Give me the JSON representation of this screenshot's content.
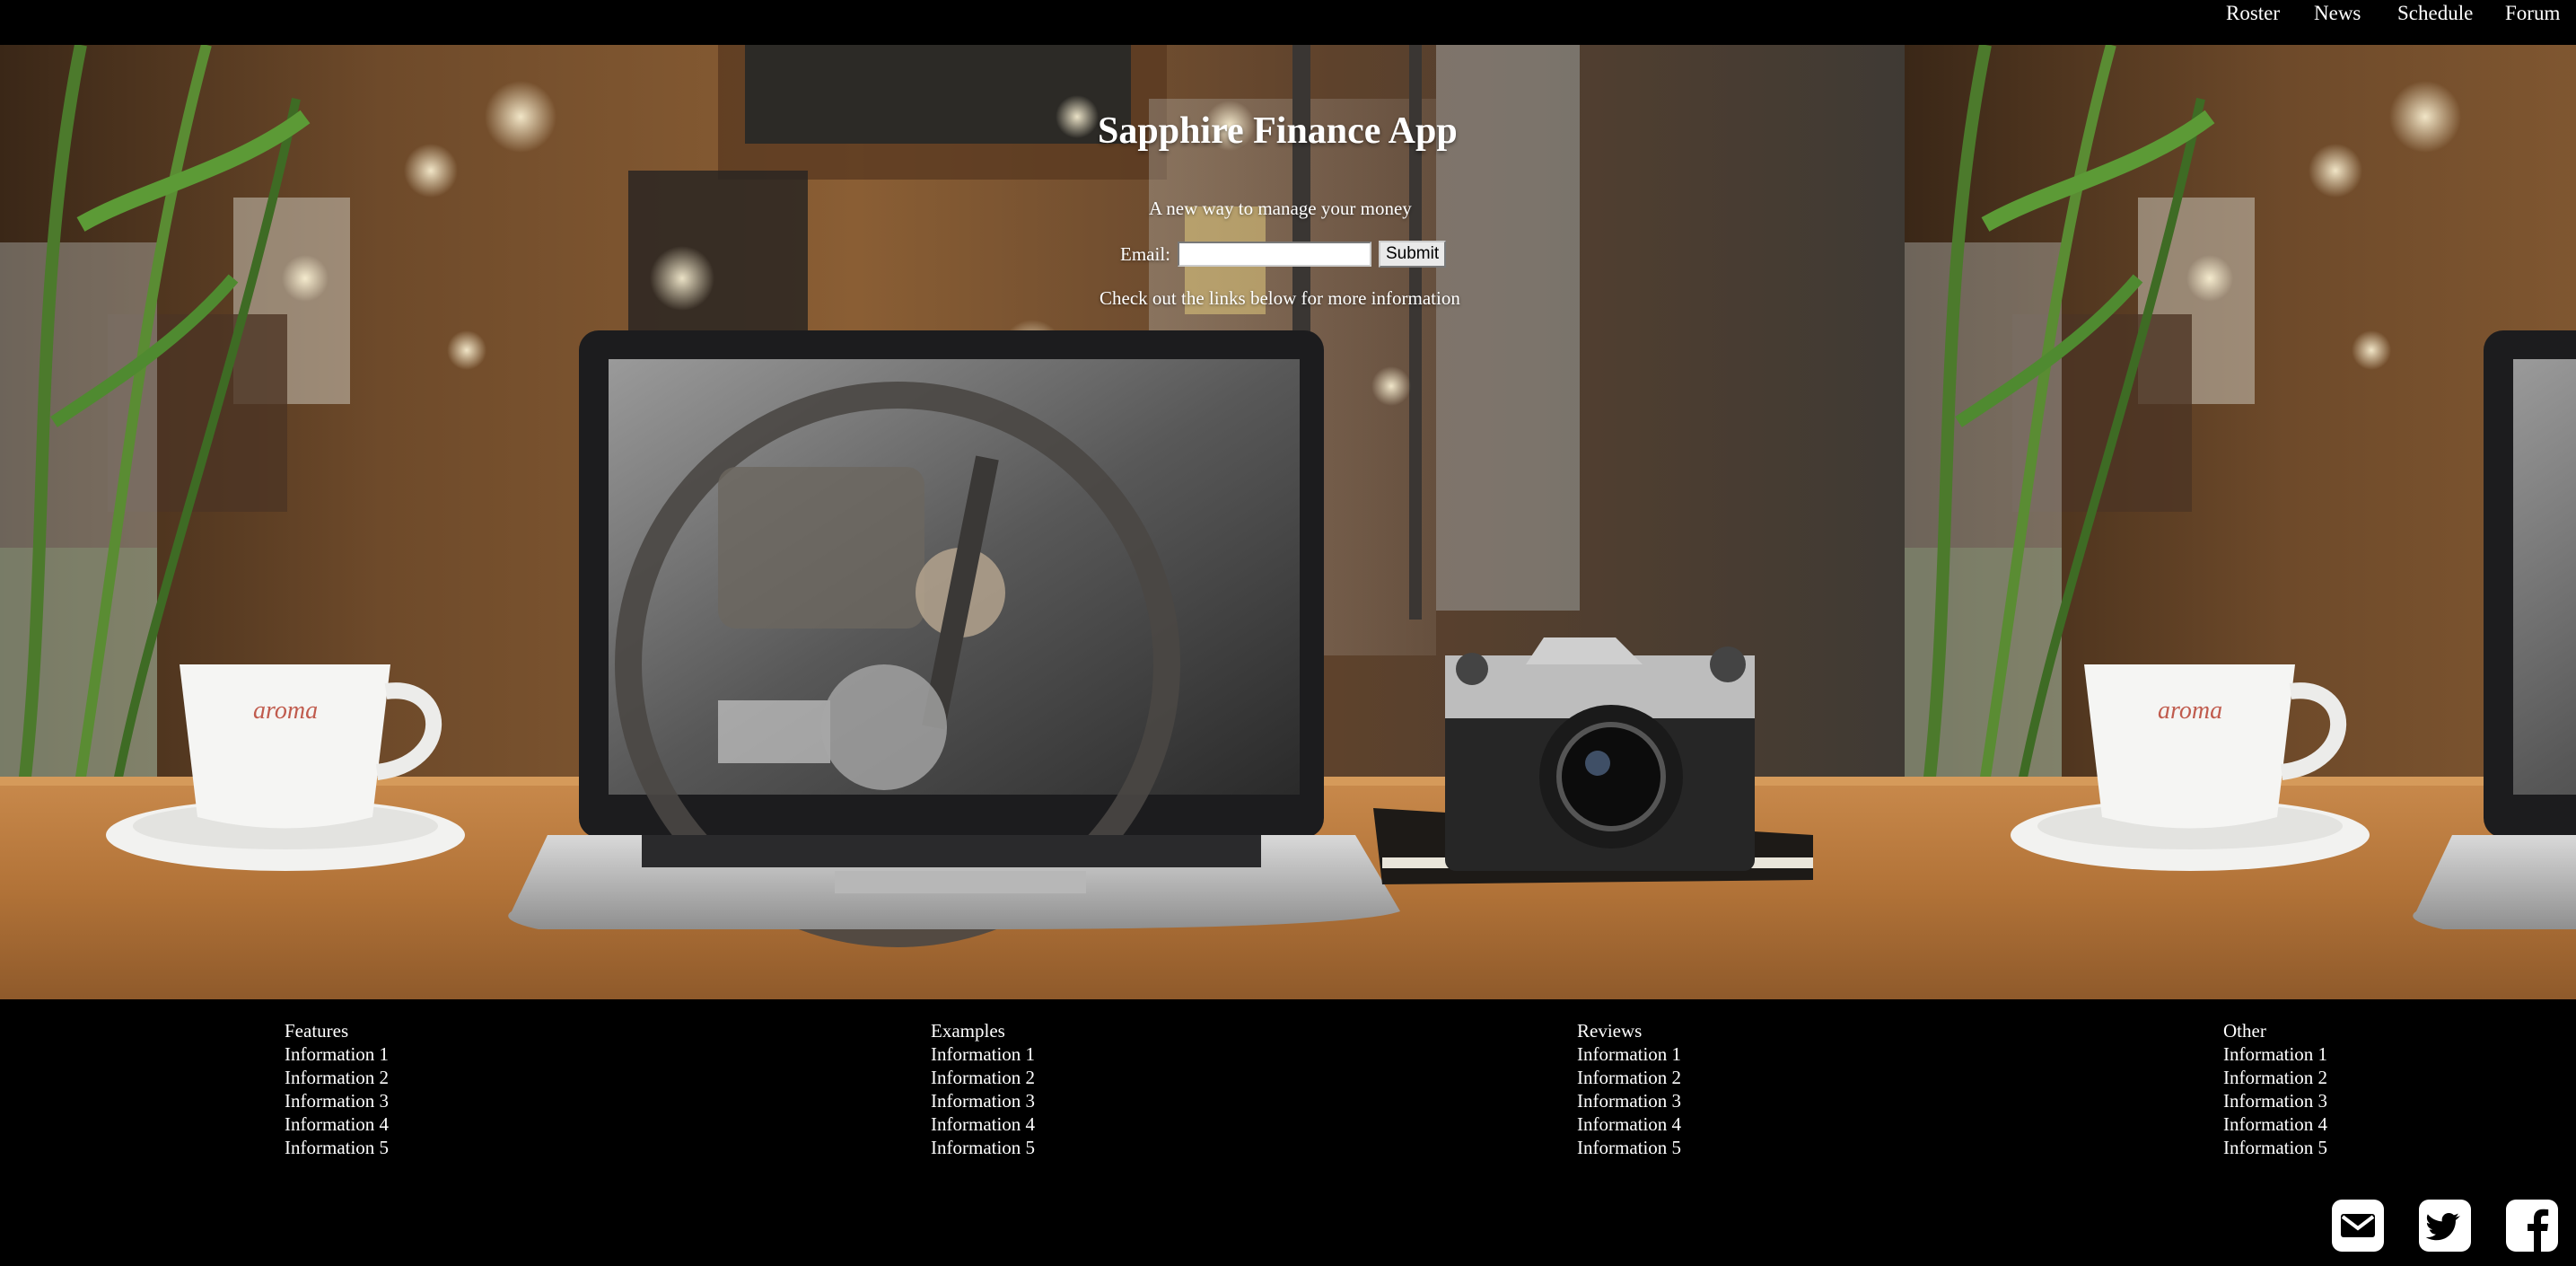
{
  "nav": {
    "items": [
      {
        "label": "Roster"
      },
      {
        "label": "News"
      },
      {
        "label": "Schedule"
      },
      {
        "label": "Forum"
      }
    ]
  },
  "hero": {
    "title": "Sapphire Finance App",
    "tagline": "A new way to manage your money",
    "email_label": "Email:",
    "email_value": "",
    "email_placeholder": "",
    "submit_label": "Submit",
    "more_text": "Check out the links below for more information",
    "cup_logo_text": "aroma"
  },
  "footer": {
    "columns": [
      {
        "title": "Features",
        "links": [
          "Information 1",
          "Information 2",
          "Information 3",
          "Information 4",
          "Information 5"
        ]
      },
      {
        "title": "Examples",
        "links": [
          "Information 1",
          "Information 2",
          "Information 3",
          "Information 4",
          "Information 5"
        ]
      },
      {
        "title": "Reviews",
        "links": [
          "Information 1",
          "Information 2",
          "Information 3",
          "Information 4",
          "Information 5"
        ]
      },
      {
        "title": "Other",
        "links": [
          "Information 1",
          "Information 2",
          "Information 3",
          "Information 4",
          "Information 5"
        ]
      }
    ]
  },
  "social": {
    "icons": [
      "envelope-icon",
      "twitter-icon",
      "facebook-icon"
    ]
  },
  "colors": {
    "background": "#000000",
    "text": "#ffffff",
    "desk": "#b9783c"
  }
}
